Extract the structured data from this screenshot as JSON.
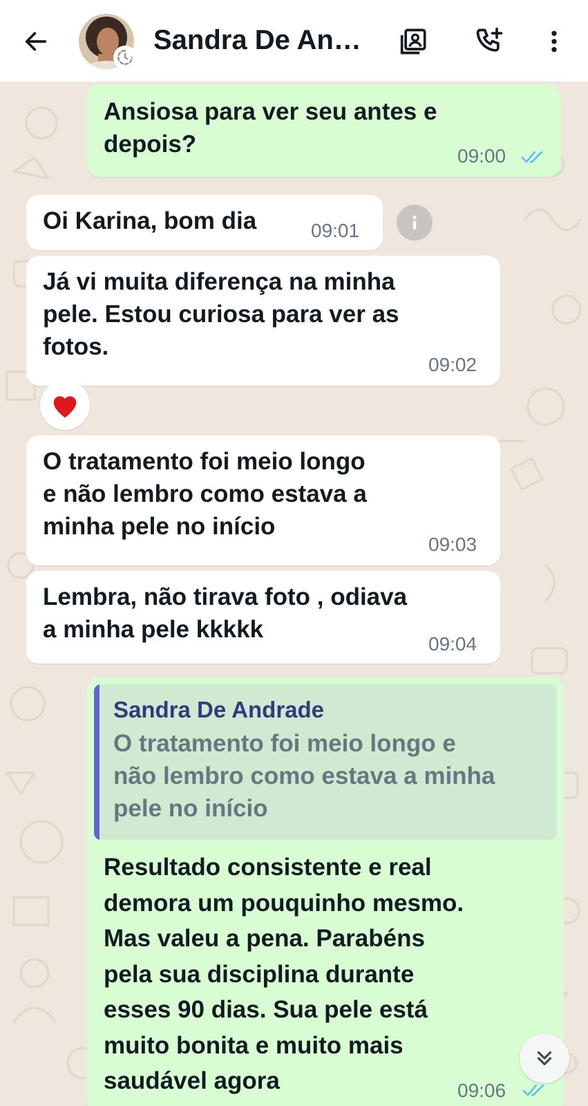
{
  "header": {
    "contact_name": "Sandra De An…",
    "back_icon": "arrow-left-icon",
    "contacts_icon": "contact-card-icon",
    "add_call_icon": "phone-plus-icon",
    "menu_icon": "more-vertical-icon"
  },
  "messages": [
    {
      "direction": "out",
      "text": "Ansiosa para ver seu antes e\ndepois?",
      "time": "09:00",
      "read": true
    },
    {
      "direction": "in",
      "text": "Oi Karina, bom dia",
      "time": "09:01"
    },
    {
      "direction": "in",
      "text": "Já vi muita diferença na minha\npele. Estou curiosa para ver as\nfotos.",
      "time": "09:02",
      "reaction": "❤️"
    },
    {
      "direction": "in",
      "text": "O tratamento foi meio longo\ne não lembro como estava a\nminha pele no início",
      "time": "09:03"
    },
    {
      "direction": "in",
      "text": "Lembra, não tirava foto , odiava\na minha pele kkkkk",
      "time": "09:04"
    },
    {
      "direction": "out",
      "quote": {
        "author": "Sandra De Andrade",
        "text": "O tratamento foi meio longo e\nnão lembro como estava a minha\npele no início"
      },
      "text": "Resultado  consistente e real\ndemora um pouquinho mesmo.\nMas valeu a pena. Parabéns\npela sua disciplina durante\nesses 90 dias. Sua pele está\nmuito bonita e muito mais\nsaudável agora",
      "time": "09:06",
      "read": true
    }
  ],
  "colors": {
    "outgoing_bubble": "#d9fdd3",
    "incoming_bubble": "#ffffff",
    "read_ticks": "#53bdeb",
    "quote_bar": "#5f66cd"
  }
}
